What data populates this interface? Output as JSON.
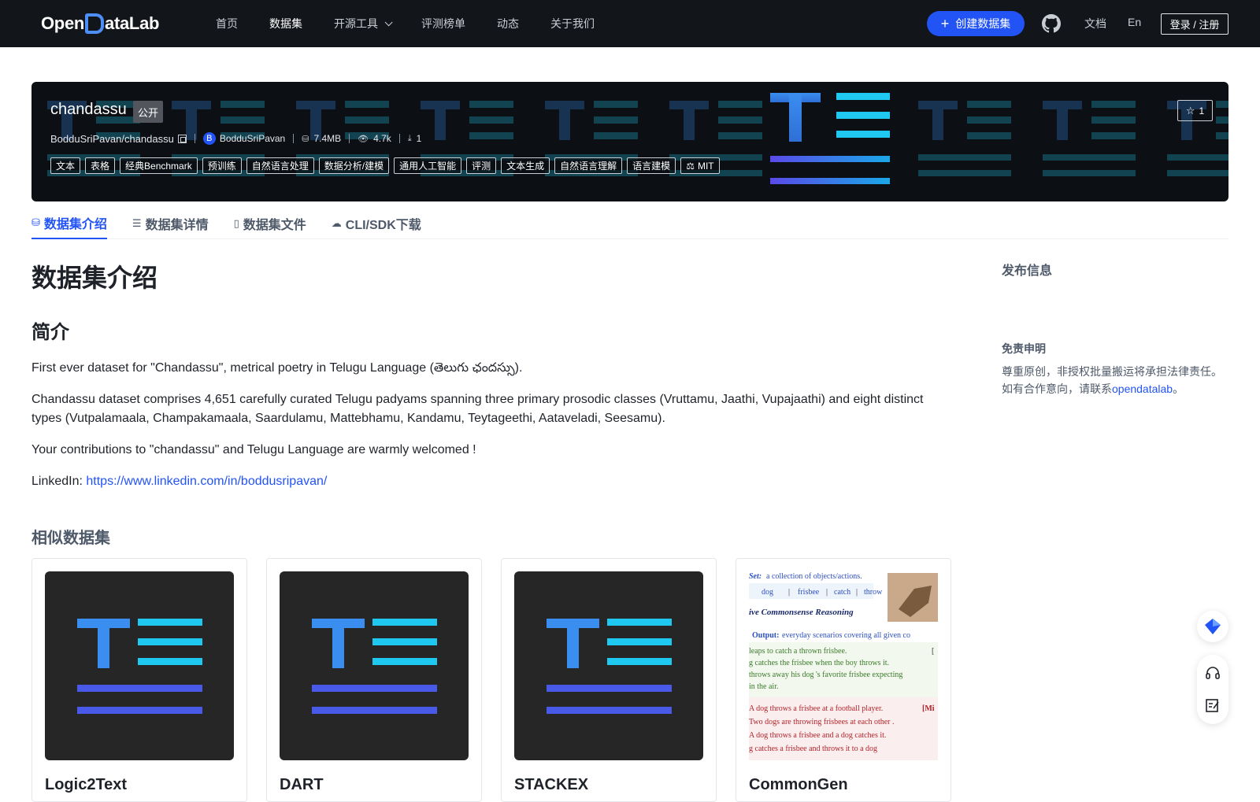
{
  "nav": {
    "logo_pre": "Open",
    "logo_mid": "D",
    "logo_post": "ataLab",
    "links": [
      {
        "label": "首页",
        "active": false
      },
      {
        "label": "数据集",
        "active": true
      },
      {
        "label": "开源工具",
        "active": false,
        "dropdown": true
      },
      {
        "label": "评测榜单",
        "active": false
      },
      {
        "label": "动态",
        "active": false
      },
      {
        "label": "关于我们",
        "active": false
      }
    ],
    "create_label": "创建数据集",
    "docs_label": "文档",
    "lang_label": "En",
    "login_label": "登录 / 注册"
  },
  "dataset": {
    "name": "chandassu",
    "visibility": "公开",
    "full_name": "BodduSriPavan/chandassu",
    "author_initial": "B",
    "author": "BodduSriPavan",
    "size": "7.4MB",
    "views": "4.7k",
    "downloads": "1",
    "stars": "1",
    "tags": [
      "文本",
      "表格",
      "经典Benchmark",
      "预训练",
      "自然语言处理",
      "数据分析/建模",
      "通用人工智能",
      "评测",
      "文本生成",
      "自然语言理解",
      "语言建模"
    ],
    "license": "MIT"
  },
  "tabs": [
    {
      "label": "数据集介绍",
      "icon": "database-icon",
      "active": true
    },
    {
      "label": "数据集详情",
      "icon": "list-icon",
      "active": false
    },
    {
      "label": "数据集文件",
      "icon": "file-icon",
      "active": false
    },
    {
      "label": "CLI/SDK下载",
      "icon": "cloud-icon",
      "active": false
    }
  ],
  "content": {
    "heading": "数据集介绍",
    "intro_heading": "简介",
    "p1": "First ever dataset for \"Chandassu\", metrical poetry in Telugu Language (తెలుగు ఛందస్సు).",
    "p2": "Chandassu dataset comprises 4,651 carefully curated Telugu padyams spanning three primary prosodic classes (Vruttamu, Jaathi, Vupajaathi) and eight distinct types (Vutpalamaala, Champakamaala, Saardulamu, Mattebhamu, Kandamu, Teytageethi, Aataveladi, Seesamu).",
    "p3": "Your contributions to \"chandassu\" and Telugu Language are warmly welcomed !",
    "p4_label": "LinkedIn: ",
    "p4_link": "https://www.linkedin.com/in/boddusripavan/"
  },
  "similar": {
    "title": "相似数据集",
    "items": [
      {
        "name": "Logic2Text"
      },
      {
        "name": "DART"
      },
      {
        "name": "STACKEX"
      },
      {
        "name": "CommonGen"
      }
    ]
  },
  "commongen_thumb": {
    "set_label": "Set:",
    "set_text": "a collection of objects/actions.",
    "words": [
      "dog",
      "frisbee",
      "catch",
      "throw"
    ],
    "reasoning": "ive Commonsense Reasoning",
    "output_label": "Output:",
    "output_text": "everyday scenarios covering all given co",
    "green_lines": [
      "leaps to catch a thrown frisbee.",
      "g catches the frisbee when the boy throws it.",
      "throws away his dog 's favorite frisbee expecting",
      "in the air."
    ],
    "red_lines": [
      "A dog throws a frisbee at a football player.",
      "Two dogs are throwing frisbees at each other .",
      "A dog throws a frisbee and a dog catches it.",
      "g catches a frisbee and throws it to a dog"
    ],
    "bracket_1": "[",
    "bracket_2": "[Mi"
  },
  "sidebar": {
    "title": "发布信息",
    "disclaimer_title": "免责申明",
    "disclaimer_line1": "尊重原创，非授权批量搬运将承担法律责任。",
    "disclaimer_line2_pre": "如有合作意向，请联系",
    "disclaimer_link": "opendatalab",
    "disclaimer_line2_post": "。"
  },
  "colors": {
    "brand": "#2253f5",
    "nav_bg": "#121519",
    "logo_blue": "#4d8ef8",
    "thumb_t": "#3a8ef0",
    "thumb_lines": "#1ec8f0",
    "thumb_bar": "#4a5ae8"
  }
}
